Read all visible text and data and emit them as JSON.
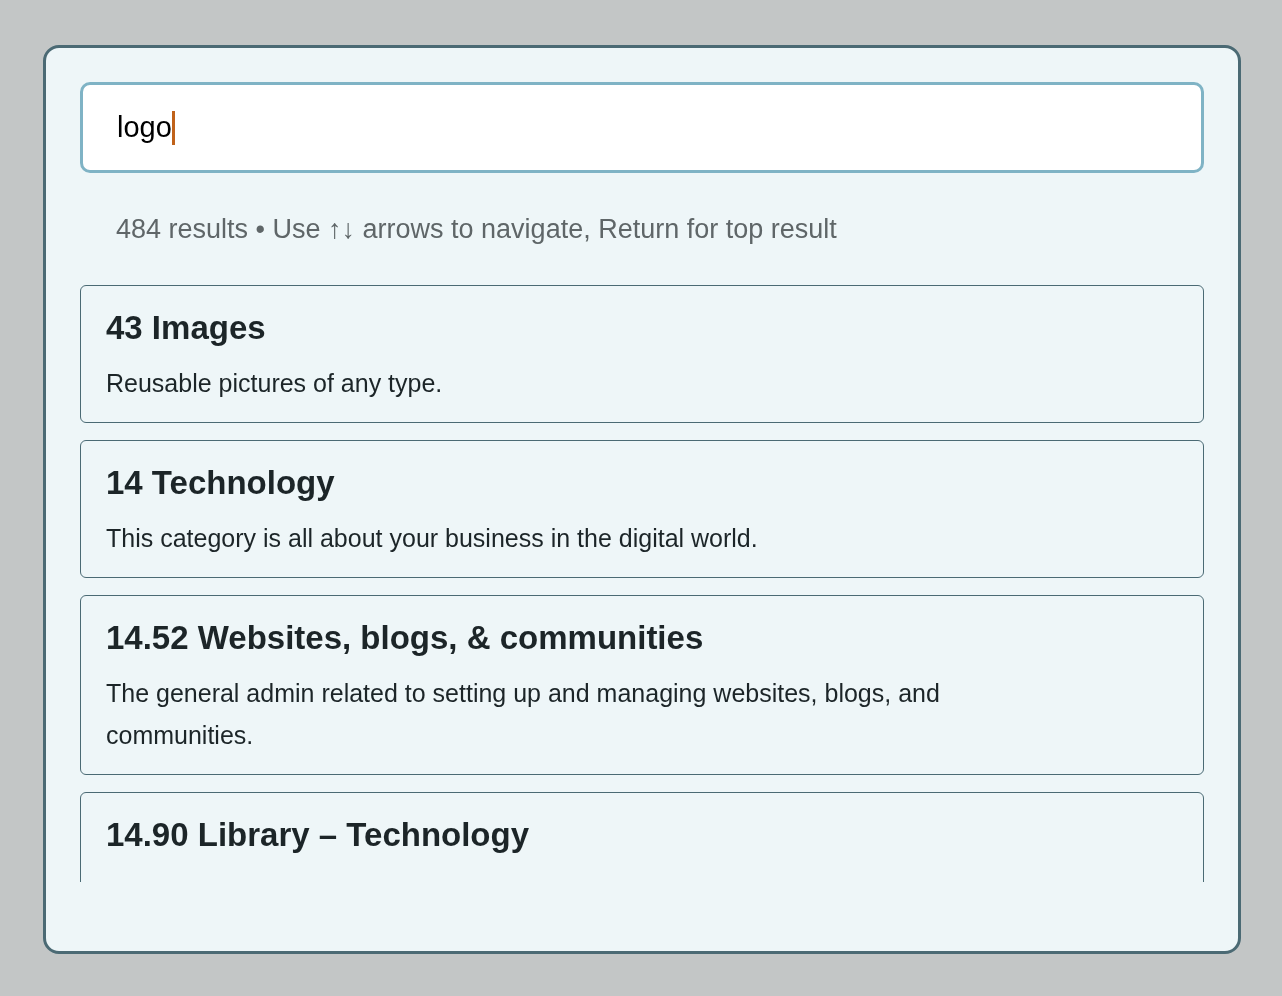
{
  "search": {
    "value": "logo"
  },
  "status": "484 results • Use ↑↓ arrows to navigate, Return for top result",
  "results": [
    {
      "title": "43 Images",
      "description": "Reusable pictures of any type."
    },
    {
      "title": "14 Technology",
      "description": "This category is all about your business in the digital world."
    },
    {
      "title": "14.52 Websites, blogs, & communities",
      "description": "The general admin related to setting up and managing websites, blogs, and communities."
    },
    {
      "title": "14.90 Library – Technology"
    }
  ]
}
